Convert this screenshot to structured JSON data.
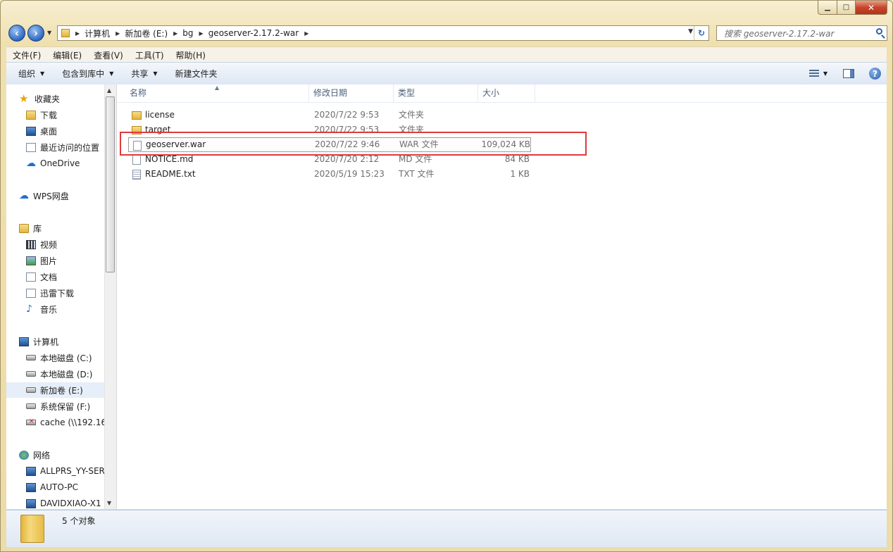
{
  "window": {
    "buttons": {
      "minimize": "▁",
      "maximize": "□",
      "close": "✕"
    }
  },
  "address": {
    "crumbs": [
      "计算机",
      "新加卷 (E:)",
      "bg",
      "geoserver-2.17.2-war"
    ],
    "search_placeholder": "搜索 geoserver-2.17.2-war"
  },
  "menu": [
    "文件(F)",
    "编辑(E)",
    "查看(V)",
    "工具(T)",
    "帮助(H)"
  ],
  "toolbar": {
    "organize": "组织",
    "include_in_library": "包含到库中",
    "share": "共享",
    "new_folder": "新建文件夹",
    "help": "?"
  },
  "nav": {
    "favorites": {
      "label": "收藏夹",
      "items": [
        "下载",
        "桌面",
        "最近访问的位置",
        "OneDrive"
      ]
    },
    "wps": "WPS网盘",
    "libraries": {
      "label": "库",
      "items": [
        "视频",
        "图片",
        "文档",
        "迅雷下载",
        "音乐"
      ]
    },
    "computer": {
      "label": "计算机",
      "items": [
        "本地磁盘 (C:)",
        "本地磁盘 (D:)",
        "新加卷 (E:)",
        "系统保留 (F:)",
        "cache (\\\\192.16"
      ]
    },
    "network": {
      "label": "网络",
      "items": [
        "ALLPRS_YY-SERV",
        "AUTO-PC",
        "DAVIDXIAO-X1"
      ]
    },
    "selected": "新加卷 (E:)"
  },
  "columns": {
    "name": "名称",
    "date": "修改日期",
    "type": "类型",
    "size": "大小"
  },
  "files": [
    {
      "name": "license",
      "date": "2020/7/22 9:53",
      "type": "文件夹",
      "size": "",
      "icon": "folder-icon"
    },
    {
      "name": "target",
      "date": "2020/7/22 9:53",
      "type": "文件夹",
      "size": "",
      "icon": "folder-icon"
    },
    {
      "name": "geoserver.war",
      "date": "2020/7/22 9:46",
      "type": "WAR 文件",
      "size": "109,024 KB",
      "icon": "file-icon",
      "selected": true
    },
    {
      "name": "NOTICE.md",
      "date": "2020/7/20 2:12",
      "type": "MD 文件",
      "size": "84 KB",
      "icon": "file-icon"
    },
    {
      "name": "README.txt",
      "date": "2020/5/19 15:23",
      "type": "TXT 文件",
      "size": "1 KB",
      "icon": "text-file-icon"
    }
  ],
  "status": {
    "count": "5 个对象"
  },
  "colors": {
    "highlight": "#e0393b",
    "selection": "#e6eef9"
  }
}
